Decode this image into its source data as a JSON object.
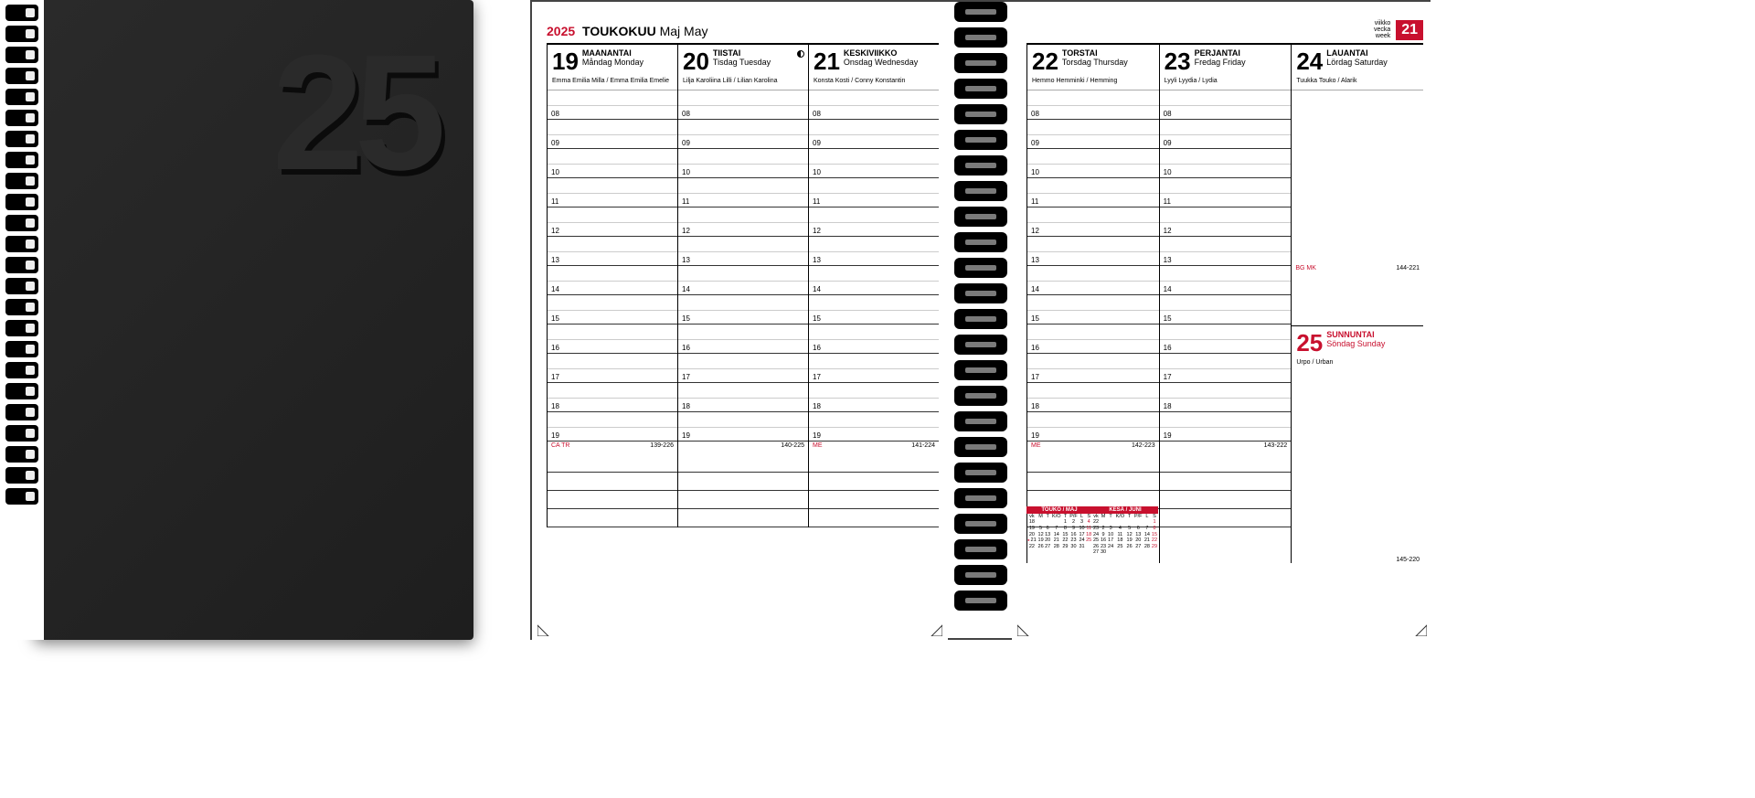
{
  "cover": {
    "year": "25"
  },
  "header": {
    "year": "2025",
    "month_main": "TOUKOKUU",
    "month_alt": "Maj May",
    "week_labels": "viikko\nvecka\nweek",
    "week_number": "21"
  },
  "hours": [
    "08",
    "09",
    "10",
    "11",
    "12",
    "13",
    "14",
    "15",
    "16",
    "17",
    "18",
    "19"
  ],
  "left_days": [
    {
      "num": "19",
      "name": "MAANANTAI",
      "alt": "Måndag Monday",
      "names": "Emma Emilia Milla / Emma Emilia Emelie",
      "foot": "CA TR",
      "index": "139-226",
      "moon": false
    },
    {
      "num": "20",
      "name": "TIISTAI",
      "alt": "Tisdag Tuesday",
      "names": "Lilja Karoliina Lilli / Lilian Karolina",
      "foot": "",
      "index": "140-225",
      "moon": true
    },
    {
      "num": "21",
      "name": "KESKIVIIKKO",
      "alt": "Onsdag Wednesday",
      "names": "Konsta Kosti / Conny Konstantin",
      "foot": "ME",
      "index": "141-224",
      "moon": false
    }
  ],
  "right_days": [
    {
      "num": "22",
      "name": "TORSTAI",
      "alt": "Torsdag Thursday",
      "names": "Hemmo Hemminki / Hemming",
      "foot": "ME",
      "index": "142-223"
    },
    {
      "num": "23",
      "name": "PERJANTAI",
      "alt": "Fredag Friday",
      "names": "Lyyli Lyydia / Lydia",
      "foot": "",
      "index": "143-222"
    }
  ],
  "saturday": {
    "num": "24",
    "name": "LAUANTAI",
    "alt": "Lördag Saturday",
    "names": "Tuukka Touko / Alarik",
    "foot": "BG MK",
    "index": "144-221"
  },
  "sunday": {
    "num": "25",
    "name": "SUNNUNTAI",
    "alt": "Söndag Sunday",
    "names": "Urpo / Urban",
    "foot": "",
    "index": "145-220"
  },
  "minical_may": {
    "title": "TOUKO / MAJ",
    "dow": [
      "vk",
      "M",
      "T",
      "K/O",
      "T",
      "P/F",
      "L",
      "S"
    ],
    "rows": [
      [
        "18",
        "",
        "",
        "",
        "1",
        "2",
        "3",
        "4"
      ],
      [
        "19",
        "5",
        "6",
        "7",
        "8",
        "9",
        "10",
        "11"
      ],
      [
        "20",
        "12",
        "13",
        "14",
        "15",
        "16",
        "17",
        "18"
      ],
      [
        "21",
        "19",
        "20",
        "21",
        "22",
        "23",
        "24",
        "25"
      ],
      [
        "22",
        "26",
        "27",
        "28",
        "29",
        "30",
        "31",
        ""
      ]
    ],
    "highlight_row": 3
  },
  "minical_jun": {
    "title": "KESÄ / JUNI",
    "dow": [
      "vk",
      "M",
      "T",
      "K/O",
      "T",
      "P/F",
      "L",
      "S"
    ],
    "rows": [
      [
        "22",
        "",
        "",
        "",
        "",
        "",
        "",
        "1"
      ],
      [
        "23",
        "2",
        "3",
        "4",
        "5",
        "6",
        "7",
        "8"
      ],
      [
        "24",
        "9",
        "10",
        "11",
        "12",
        "13",
        "14",
        "15"
      ],
      [
        "25",
        "16",
        "17",
        "18",
        "19",
        "20",
        "21",
        "22"
      ],
      [
        "26",
        "23",
        "24",
        "25",
        "26",
        "27",
        "28",
        "29"
      ],
      [
        "27",
        "30",
        "",
        "",
        "",
        "",
        "",
        ""
      ]
    ]
  }
}
